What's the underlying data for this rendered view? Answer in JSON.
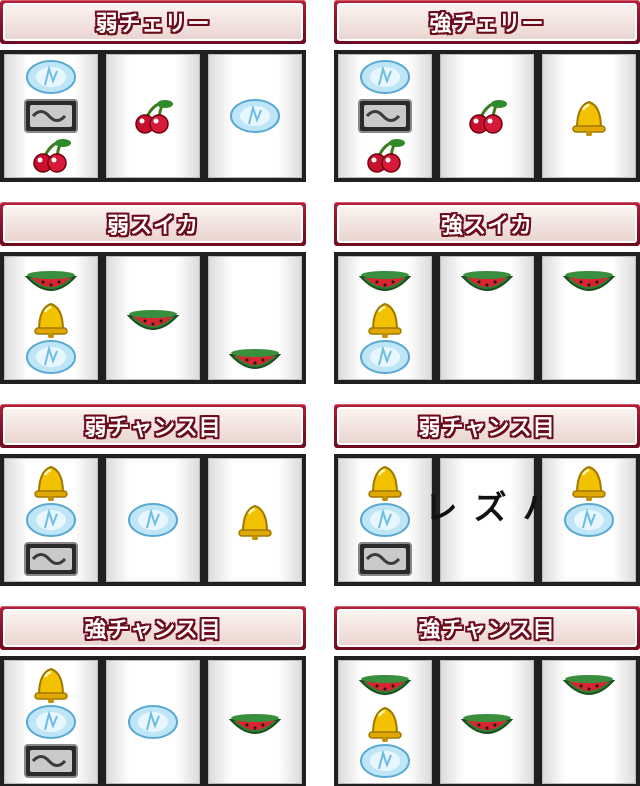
{
  "panels": [
    {
      "title": "弱チェリー",
      "reels": [
        [
          "ice",
          "bar",
          "cherry"
        ],
        [
          null,
          "cherry",
          null
        ],
        [
          null,
          "ice",
          null
        ]
      ]
    },
    {
      "title": "強チェリー",
      "reels": [
        [
          "ice",
          "bar",
          "cherry"
        ],
        [
          null,
          "cherry",
          null
        ],
        [
          null,
          "bell",
          null
        ]
      ]
    },
    {
      "title": "弱スイカ",
      "reels": [
        [
          "melon",
          "bell",
          "ice"
        ],
        [
          null,
          "melon",
          null
        ],
        [
          null,
          null,
          "melon"
        ]
      ]
    },
    {
      "title": "強スイカ",
      "reels": [
        [
          "melon",
          "bell",
          "ice"
        ],
        [
          "melon",
          null,
          null
        ],
        [
          "melon",
          null,
          null
        ]
      ]
    },
    {
      "title": "弱チャンス目",
      "reels": [
        [
          "bell",
          "ice",
          "bar"
        ],
        [
          null,
          "ice",
          null
        ],
        [
          null,
          "bell",
          null
        ]
      ]
    },
    {
      "title": "弱チャンス目",
      "reels": [
        [
          "bell",
          "ice",
          "bar"
        ],
        "miss",
        [
          "bell",
          "ice",
          null
        ]
      ]
    },
    {
      "title": "強チャンス目",
      "reels": [
        [
          "bell",
          "ice",
          "bar"
        ],
        [
          null,
          "ice",
          null
        ],
        [
          null,
          "melon",
          null
        ]
      ]
    },
    {
      "title": "強チャンス目",
      "reels": [
        [
          "melon",
          "bell",
          "ice"
        ],
        [
          null,
          "melon",
          null
        ],
        [
          "melon",
          null,
          null
        ]
      ]
    }
  ],
  "miss_label": "ハズレ",
  "symbol_icons": {
    "ice": "ice-crystal-icon",
    "bar": "bar-plate-icon",
    "cherry": "cherry-icon",
    "bell": "bell-icon",
    "melon": "watermelon-icon"
  },
  "colors": {
    "header": "#8e1328",
    "reel_frame": "#202020",
    "ice": "#8fd3f0",
    "cherry": "#c8102e",
    "bell": "#f2c200",
    "melon": "#d9252f",
    "bar": "#444444"
  }
}
